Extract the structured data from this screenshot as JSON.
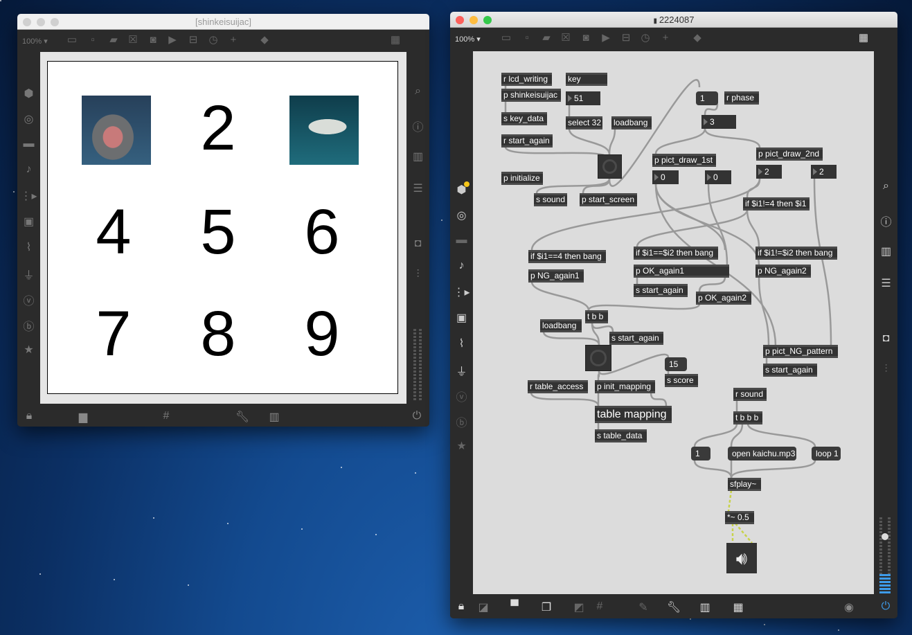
{
  "left_window": {
    "title": "[shinkeisuijac]",
    "zoom_label": "100% ▾",
    "grid_digits": [
      "2",
      "4",
      "5",
      "6",
      "7",
      "8",
      "9"
    ],
    "images": [
      "great-white-shark-photo",
      "hammerhead-shark-photo"
    ]
  },
  "right_window": {
    "title": "2224087",
    "zoom_label": "100% ▾",
    "objects": [
      {
        "text": "r lcd_writing",
        "kind": "object"
      },
      {
        "text": "key",
        "kind": "object"
      },
      {
        "text": "p shinkeisuijac",
        "kind": "object"
      },
      {
        "text": "51",
        "kind": "number"
      },
      {
        "text": "s key_data",
        "kind": "object"
      },
      {
        "text": "select 32",
        "kind": "object"
      },
      {
        "text": "loadbang",
        "kind": "object"
      },
      {
        "text": "r start_again",
        "kind": "object"
      },
      {
        "text": "p initialize",
        "kind": "object"
      },
      {
        "text": "s sound",
        "kind": "object"
      },
      {
        "text": "p start_screen",
        "kind": "object"
      },
      {
        "text": "1",
        "kind": "message"
      },
      {
        "text": "r phase",
        "kind": "object"
      },
      {
        "text": "3",
        "kind": "number"
      },
      {
        "text": "p pict_draw_1st",
        "kind": "object"
      },
      {
        "text": "0",
        "kind": "number"
      },
      {
        "text": "0",
        "kind": "number"
      },
      {
        "text": "p pict_draw_2nd",
        "kind": "object"
      },
      {
        "text": "2",
        "kind": "number"
      },
      {
        "text": "2",
        "kind": "number"
      },
      {
        "text": "if $i1!=4 then $i1",
        "kind": "object"
      },
      {
        "text": "if $i1==4 then bang",
        "kind": "object"
      },
      {
        "text": "if $i1==$i2 then bang",
        "kind": "object"
      },
      {
        "text": "if $i1!=$i2 then bang",
        "kind": "object"
      },
      {
        "text": "p NG_again1",
        "kind": "object"
      },
      {
        "text": "p OK_again1",
        "kind": "object"
      },
      {
        "text": "p NG_again2",
        "kind": "object"
      },
      {
        "text": "s start_again",
        "kind": "object"
      },
      {
        "text": "p OK_again2",
        "kind": "object"
      },
      {
        "text": "t b b",
        "kind": "object"
      },
      {
        "text": "loadbang",
        "kind": "object"
      },
      {
        "text": "s start_again",
        "kind": "object"
      },
      {
        "text": "15",
        "kind": "message"
      },
      {
        "text": "s score",
        "kind": "object"
      },
      {
        "text": "p pict_NG_pattern",
        "kind": "object"
      },
      {
        "text": "s start_again",
        "kind": "object"
      },
      {
        "text": "r table_access",
        "kind": "object"
      },
      {
        "text": "p init_mapping",
        "kind": "object"
      },
      {
        "text": "table mapping",
        "kind": "big"
      },
      {
        "text": "s table_data",
        "kind": "object"
      },
      {
        "text": "r sound",
        "kind": "object"
      },
      {
        "text": "t b b b",
        "kind": "object"
      },
      {
        "text": "1",
        "kind": "message"
      },
      {
        "text": "open kaichu.mp3",
        "kind": "message"
      },
      {
        "text": "loop 1",
        "kind": "message"
      },
      {
        "text": "sfplay~",
        "kind": "object"
      },
      {
        "text": "*~ 0.5",
        "kind": "object"
      }
    ]
  },
  "colors": {
    "accent": "#3d9be9",
    "close": "#fc605b",
    "minimize": "#fdbc40",
    "zoom": "#34c84a",
    "canvas": "#dcdcdc",
    "object": "#333333"
  }
}
